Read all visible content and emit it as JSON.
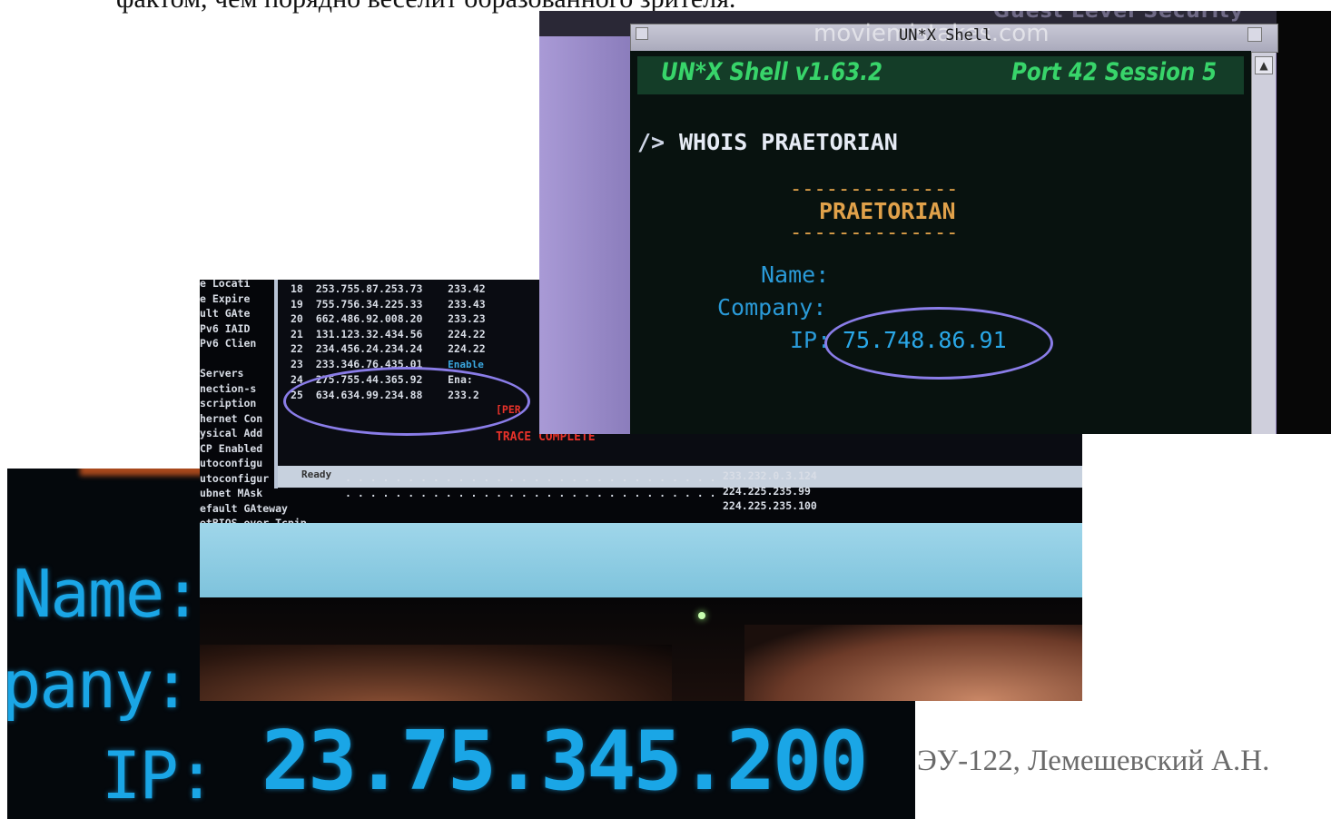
{
  "caption_top": "фактом, чем порядно веселит образованного зрителя.",
  "author": "ЭУ-122, Лемешевский А.Н.",
  "zoom_photo": {
    "name_label": "Name:",
    "company_label": "pany:",
    "ip_label": "IP:",
    "ip_value": "23.75.345.200"
  },
  "ipconfig_photo": {
    "left_labels": [
      "e Locati",
      "e Expire",
      "ult GAte",
      "Pv6 IAID",
      "Pv6 Clien",
      "",
      "Servers",
      "nection-s",
      "scription",
      "hernet Con",
      "ysical Add",
      "CP Enabled",
      "utoconfigu",
      "utoconfigur",
      "ubnet MAsk",
      "efault GAteway",
      "etBIOS over Tcpip"
    ],
    "trace_rows": [
      {
        "n": "18",
        "ip": "253.755.87.253.73",
        "right": "233.42"
      },
      {
        "n": "19",
        "ip": "755.756.34.225.33",
        "right": "233.43"
      },
      {
        "n": "20",
        "ip": "662.486.92.008.20",
        "right": "233.23"
      },
      {
        "n": "21",
        "ip": "131.123.32.434.56",
        "right": "224.22"
      },
      {
        "n": "22",
        "ip": "234.456.24.234.24",
        "right": "224.22"
      },
      {
        "n": "23",
        "ip": "233.346.76.435.01",
        "right": "Enable"
      },
      {
        "n": "24",
        "ip": "275.755.44.365.92",
        "right": "Ena:"
      },
      {
        "n": "25",
        "ip": "634.634.99.234.88",
        "right": "233.2"
      }
    ],
    "perm_label": "[PER",
    "trace_complete": "TRACE COMPLETE",
    "status_ready": "Ready",
    "lower_values": [
      "233.232.0.3.124",
      "224.225.235.99",
      "224.225.235.100"
    ]
  },
  "shell_photo": {
    "topbar_text": "Guest Level Security",
    "watermark": "moviemistakes.com",
    "window_title": "UN*X Shell",
    "header_left": "UN*X Shell   v1.63.2",
    "header_right": "Port 42   Session 5",
    "prompt": "/>",
    "command": "WHOIS PRAETORIAN",
    "dashes": "--------------",
    "result_title": "PRAETORIAN",
    "name_label": "Name:",
    "company_label": "Company:",
    "ip_label": "IP:",
    "ip_value": "75.748.86.91"
  },
  "colors": {
    "terminal_green": "#38d46a",
    "terminal_amber": "#e0a14a",
    "terminal_blue": "#1aa6e6",
    "highlight_circle": "#8a7de8",
    "trace_red": "#e8322a"
  }
}
